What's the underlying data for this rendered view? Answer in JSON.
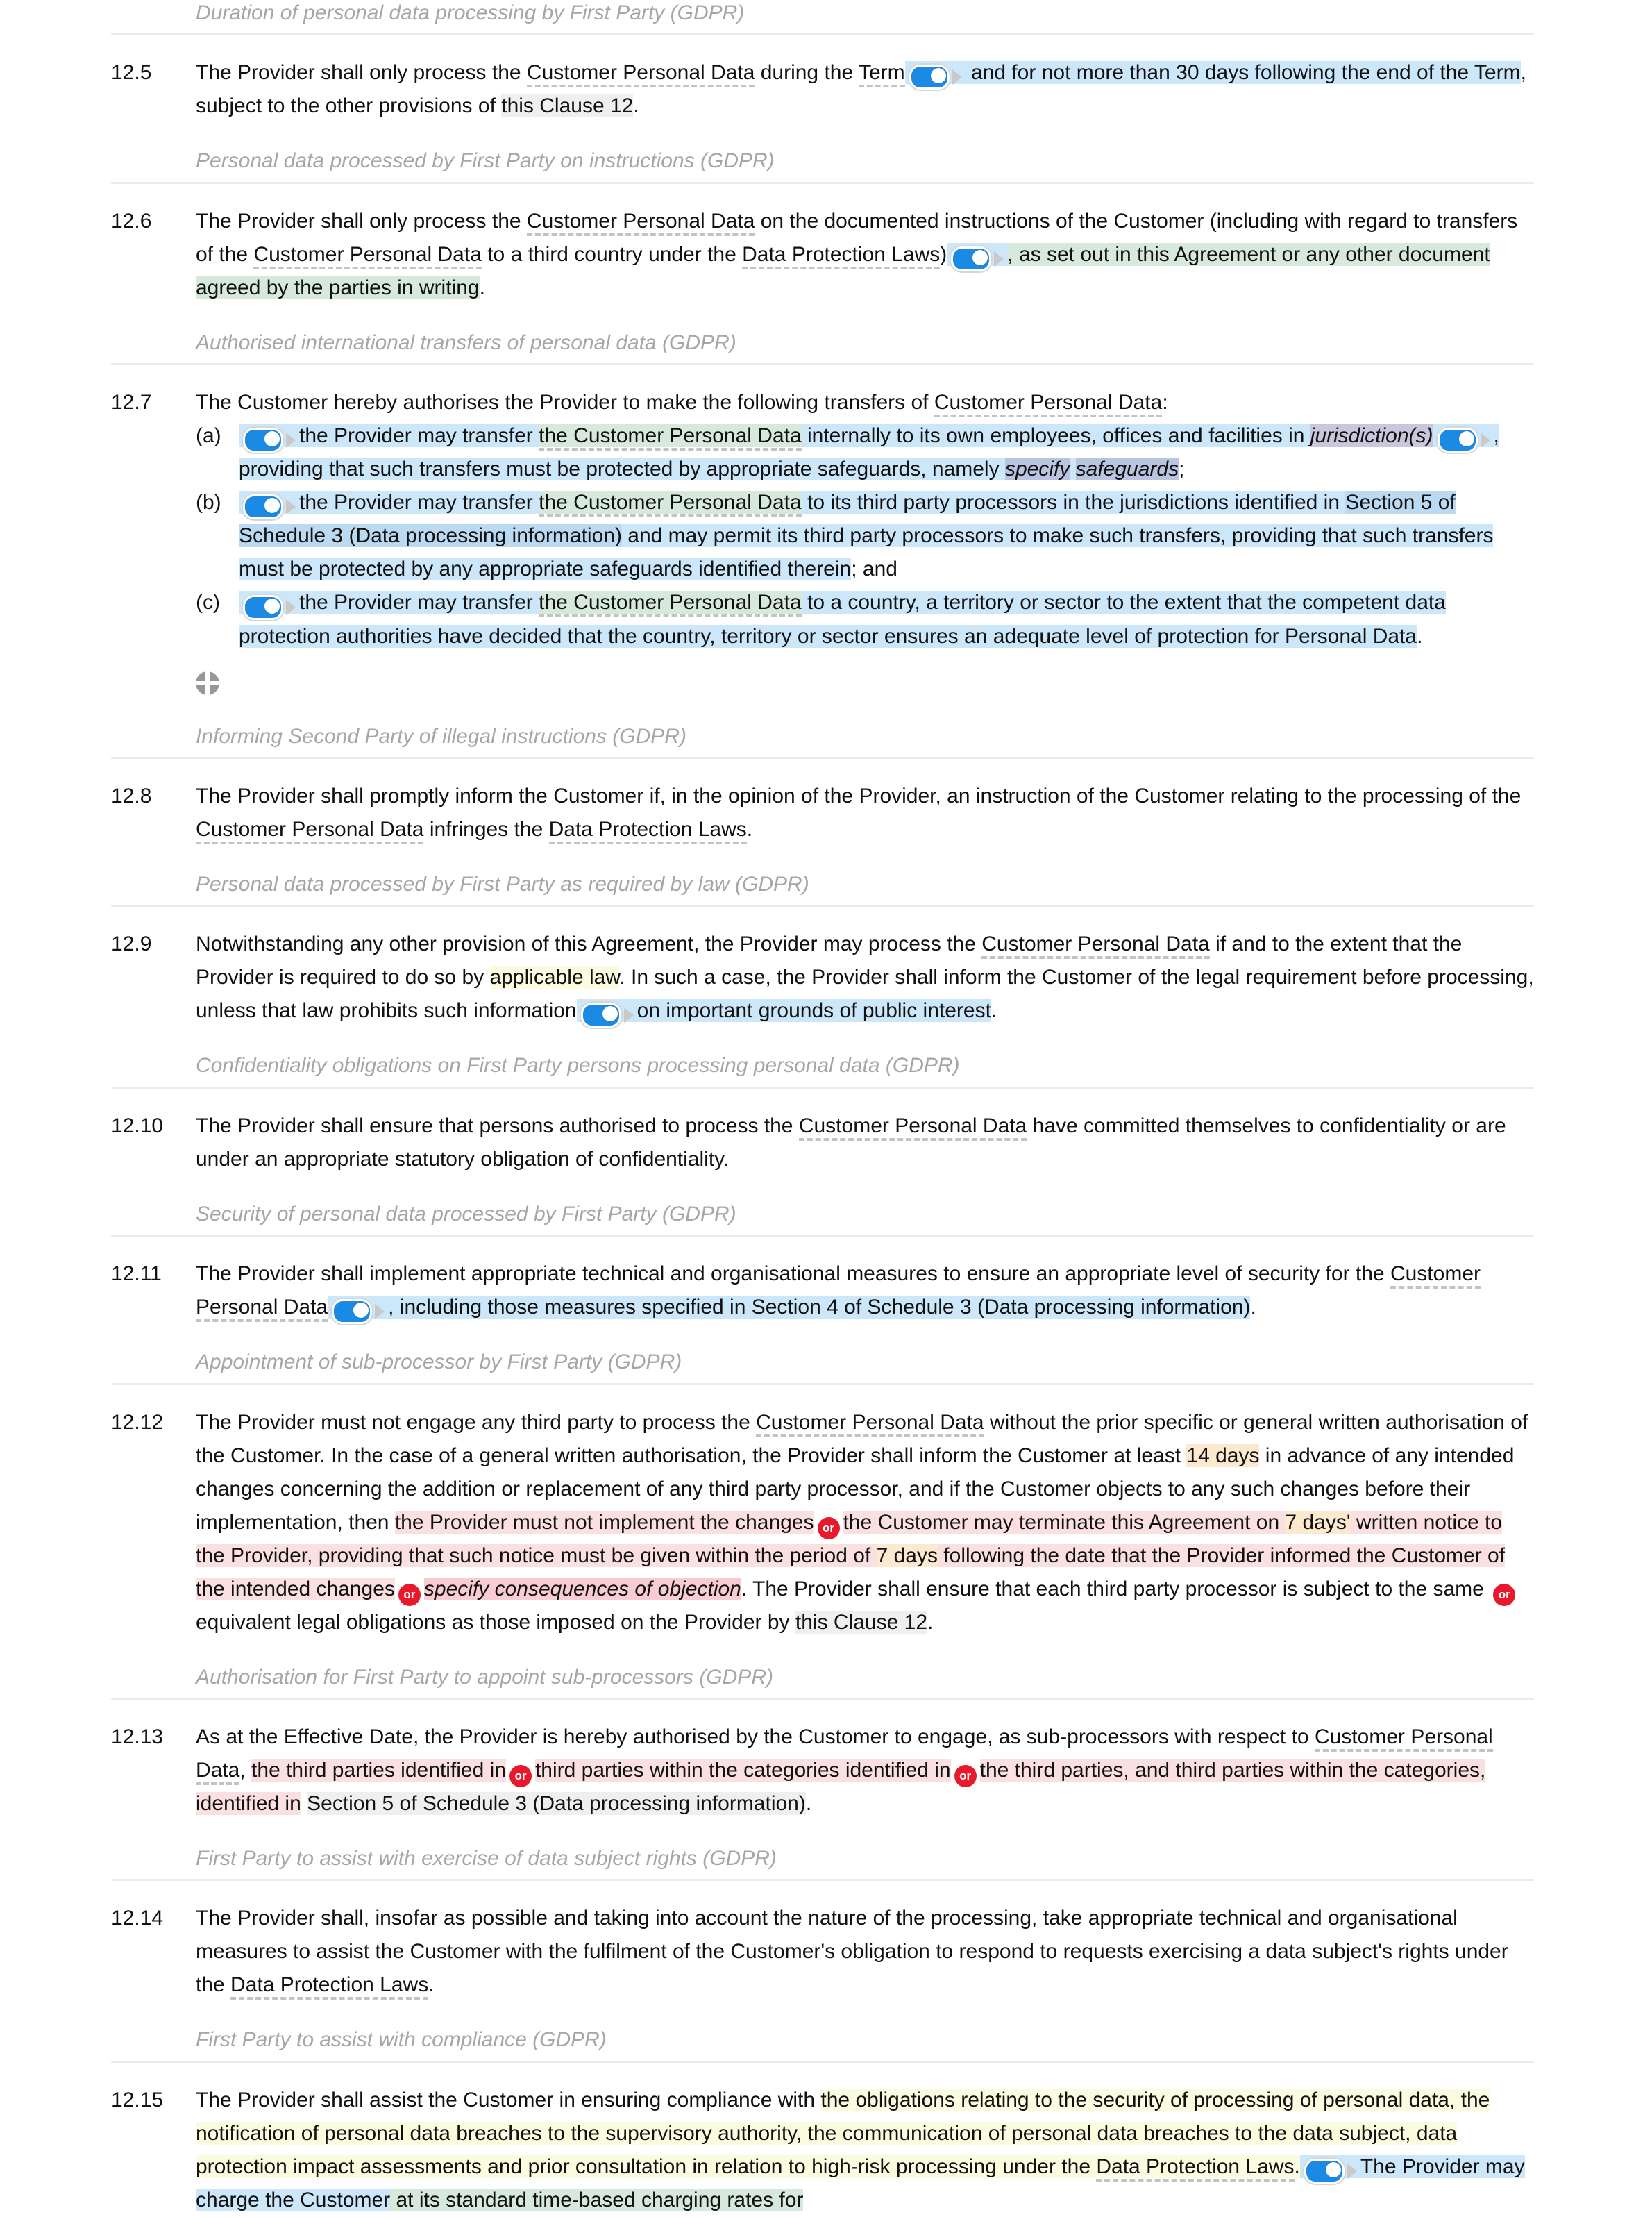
{
  "document": {
    "type": "contract-clause-editor",
    "clause_group": "12",
    "colors": {
      "highlight_blue": "#cde7fa",
      "highlight_green": "#d7e8dc",
      "highlight_pink": "#fbe0e2",
      "highlight_pink_strong": "#f8ccd1",
      "highlight_yellow": "#fbfbdf",
      "highlight_orange": "#fde9cf",
      "highlight_lavender": "#c9c7dd",
      "highlight_grey": "#efefef",
      "toggle_on": "#1a8ae5",
      "or_badge": "#e8192c",
      "heading_text": "#a6a6a6",
      "rule": "#ebebeb"
    },
    "icons": {
      "toggle_switch": "toggle-switch-on",
      "toggle_caret": "caret-right-icon",
      "or_badge_label": "or",
      "drag_handle": "move-handle-icon"
    }
  },
  "headings": {
    "h1": "Duration of personal data processing by First Party (GDPR)",
    "h2": "Personal data processed by First Party on instructions (GDPR)",
    "h3": "Authorised international transfers of personal data (GDPR)",
    "h4": "Informing Second Party of illegal instructions (GDPR)",
    "h5": "Personal data processed by First Party as required by law (GDPR)",
    "h6": "Confidentiality obligations on First Party persons processing personal data (GDPR)",
    "h7": "Security of personal data processed by First Party (GDPR)",
    "h8": "Appointment of sub-processor by First Party (GDPR)",
    "h9": "Authorisation for First Party to appoint sub-processors (GDPR)",
    "h10": "First Party to assist with exercise of data subject rights (GDPR)",
    "h11": "First Party to assist with compliance (GDPR)"
  },
  "clauses": {
    "c12_5": {
      "number": "12.5",
      "t1": "The Provider shall only process the ",
      "term1": "Customer Personal Data",
      "t2": " during the ",
      "term2": "Term",
      "t3": " and for not more than 30 days following the end of the Term",
      "t4": ", subject to the other provisions of ",
      "xref": "this Clause 12",
      "t5": "."
    },
    "c12_6": {
      "number": "12.6",
      "t1": "The Provider shall only process the ",
      "term1": "Customer Personal Data",
      "t2": " on the documented instructions of the Customer (including with regard to transfers of the ",
      "term2": "Customer Personal Data",
      "t3": " to a third country under the ",
      "term3": "Data Protection Laws",
      "t4": ")",
      "t5": ", as set out in this Agreement or any other document agreed by the parties in writing",
      "t6": "."
    },
    "c12_7": {
      "number": "12.7",
      "lead_t1": "The Customer hereby authorises the Provider to make the following transfers of ",
      "lead_term": "Customer Personal Data",
      "lead_t2": ":",
      "a": {
        "label": "(a)",
        "t1": "the Provider may transfer ",
        "green": "the Customer Personal Data",
        "t2": " internally to its own employees, offices and facilities in ",
        "placeholder1": "jurisdiction(s)",
        "t3": ", providing that such transfers must be protected by appropriate safeguards, namely ",
        "placeholder2_a": "specify",
        "placeholder2_b": "safeguards",
        "t4": ";"
      },
      "b": {
        "label": "(b)",
        "t1": "the Provider may transfer ",
        "green": "the Customer Personal Data",
        "t2": " to its third party processors in the jurisdictions identified in ",
        "xref": "Section 5 of Schedule 3 (Data processing information)",
        "t3": " and may permit its third party processors to make such transfers, providing that such transfers must be protected by any appropriate safeguards identified therein",
        "t4": "; and"
      },
      "c": {
        "label": "(c)",
        "t1": "the Provider may transfer ",
        "green": "the Customer Personal Data",
        "t2": " to a country, a territory or sector to the extent that the competent data protection authorities have decided that the country, territory or sector ensures an adequate level of protection for Personal Data",
        "t3": "."
      }
    },
    "c12_8": {
      "number": "12.8",
      "t1": "The Provider shall promptly inform the Customer if, in the opinion of the Provider, an instruction of the Customer relating to the processing of the ",
      "term1": "Customer Personal Data",
      "t2": " infringes the ",
      "term2": "Data Protection Laws",
      "t3": "."
    },
    "c12_9": {
      "number": "12.9",
      "t1": "Notwithstanding any other provision of this Agreement, the Provider may process the ",
      "term1": "Customer Personal Data",
      "t2": " if and to the extent that the Provider is required to do so by ",
      "yellow": "applicable law",
      "t3": ". In such a case, the Provider shall inform the Customer of the legal requirement before processing, unless that law prohibits such information",
      "t4": "on important grounds of public interest",
      "t5": "."
    },
    "c12_10": {
      "number": "12.10",
      "t1": "The Provider shall ensure that persons authorised to process the ",
      "term1": "Customer Personal Data",
      "t2": " have committed themselves to confidentiality or are under an appropriate statutory obligation of confidentiality."
    },
    "c12_11": {
      "number": "12.11",
      "t1": "The Provider shall implement appropriate technical and organisational measures to ensure an appropriate level of security for the ",
      "term1": "Customer Personal Data",
      "t2": ", including those measures specified in Section 4 of Schedule 3 (Data processing information)",
      "t3": "."
    },
    "c12_12": {
      "number": "12.12",
      "t1": "The Provider must not engage any third party to process the ",
      "term1": "Customer Personal Data",
      "t2": " without the prior specific or general written authorisation of the Customer. In the case of a general written authorisation, the Provider shall inform the Customer at least ",
      "orange1": "14 days",
      "t3": " in advance of any intended changes concerning the addition or replacement of any third party processor, and if the Customer objects to any such changes before their implementation, then ",
      "alt1": "the Provider must not implement the changes",
      "alt2_pre": "the Customer may terminate this Agreement on ",
      "orange2": "7 days'",
      "alt2_post": " written notice to the Provider, providing that such notice must be given within the period of ",
      "orange3": "7 days",
      "alt2_post2": " following the date that the Provider informed the Customer of the intended changes",
      "placeholder": "specify consequences of objection",
      "t4": ". The Provider shall ensure that each third party processor is subject to the same ",
      "t5": " equivalent legal obligations as those imposed on the Provider by ",
      "xref": "this Clause 12",
      "t6": "."
    },
    "c12_13": {
      "number": "12.13",
      "t1": "As at the Effective Date, the Provider is hereby authorised by the Customer to engage, as sub-processors with respect to ",
      "term1": "Customer Personal Data",
      "t2": ", ",
      "alt1": "the third parties identified in",
      "alt2": "third parties within the categories identified in",
      "alt3": "the third parties, and third parties within the categories, identified in",
      "xref": "Section 5 of Schedule 3 (Data processing information)",
      "t3": "."
    },
    "c12_14": {
      "number": "12.14",
      "t1": "The Provider shall, insofar as possible and taking into account the nature of the processing, take appropriate technical and organisational measures to assist the Customer with the fulfilment of the Customer's obligation to respond to requests exercising a data subject's rights under the ",
      "term1": "Data Protection Laws",
      "t2": "."
    },
    "c12_15": {
      "number": "12.15",
      "t1": "The Provider shall assist the Customer in ensuring compliance with ",
      "yellow": "the obligations relating to the security of processing of personal data, the notification of personal data breaches to the supervisory authority, the communication of personal data breaches to the data subject, data protection impact assessments and prior consultation in relation to high-risk processing under the ",
      "term1": "Data Protection Laws",
      "t2": ".",
      "blue": "The Provider may charge the Customer",
      "green": " at its standard time-based charging rates for"
    }
  }
}
